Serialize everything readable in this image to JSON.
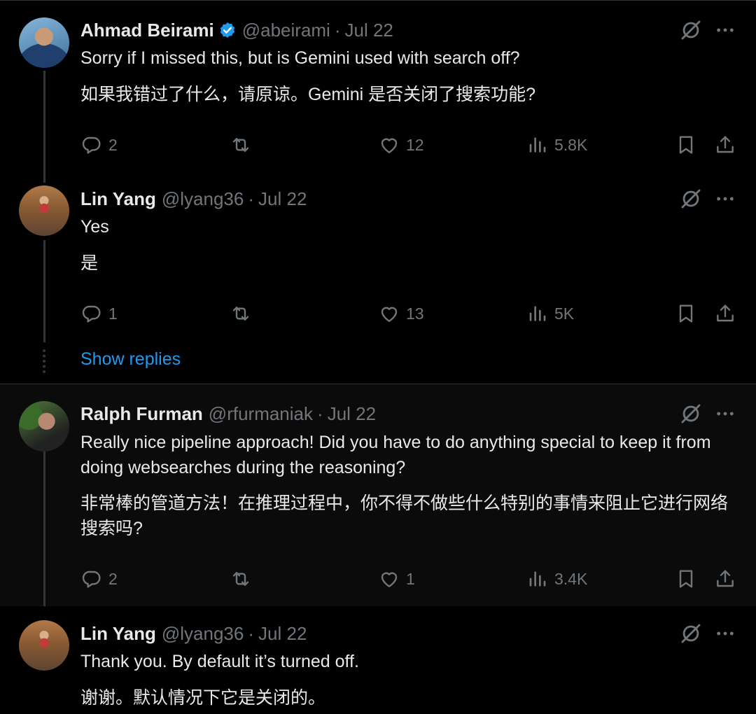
{
  "tweets": [
    {
      "name": "Ahmad Beirami",
      "verified": true,
      "handle": "@abeirami",
      "date": "Jul 22",
      "text_en": "Sorry if I missed this, but is Gemini used with search off?",
      "text_zh": "如果我错过了什么，请原谅。Gemini 是否关闭了搜索功能?",
      "replies": "2",
      "reposts": "",
      "likes": "12",
      "views": "5.8K"
    },
    {
      "name": "Lin Yang",
      "verified": false,
      "handle": "@lyang36",
      "date": "Jul 22",
      "text_en": "Yes",
      "text_zh": "是",
      "replies": "1",
      "reposts": "",
      "likes": "13",
      "views": "5K"
    },
    {
      "name": "Ralph Furman",
      "verified": false,
      "handle": "@rfurmaniak",
      "date": "Jul 22",
      "text_en": "Really nice pipeline approach!  Did you have to do anything special to keep it from doing websearches during the reasoning?",
      "text_zh": "非常棒的管道方法！在推理过程中，你不得不做些什么特别的事情来阻止它进行网络搜索吗?",
      "replies": "2",
      "reposts": "",
      "likes": "1",
      "views": "3.4K"
    },
    {
      "name": "Lin Yang",
      "verified": false,
      "handle": "@lyang36",
      "date": "Jul 22",
      "text_en": "Thank you. By default it’s turned off.",
      "text_zh": "谢谢。默认情况下它是关闭的。"
    }
  ],
  "show_replies_label": "Show replies",
  "separator": "·",
  "colors": {
    "background": "#000000",
    "text": "#e7e9ea",
    "muted": "#71767b",
    "accent": "#1d9bf0"
  },
  "icons": [
    "verified-badge-icon",
    "grok-icon",
    "more-icon",
    "reply-icon",
    "repost-icon",
    "like-icon",
    "views-icon",
    "bookmark-icon",
    "share-icon"
  ]
}
